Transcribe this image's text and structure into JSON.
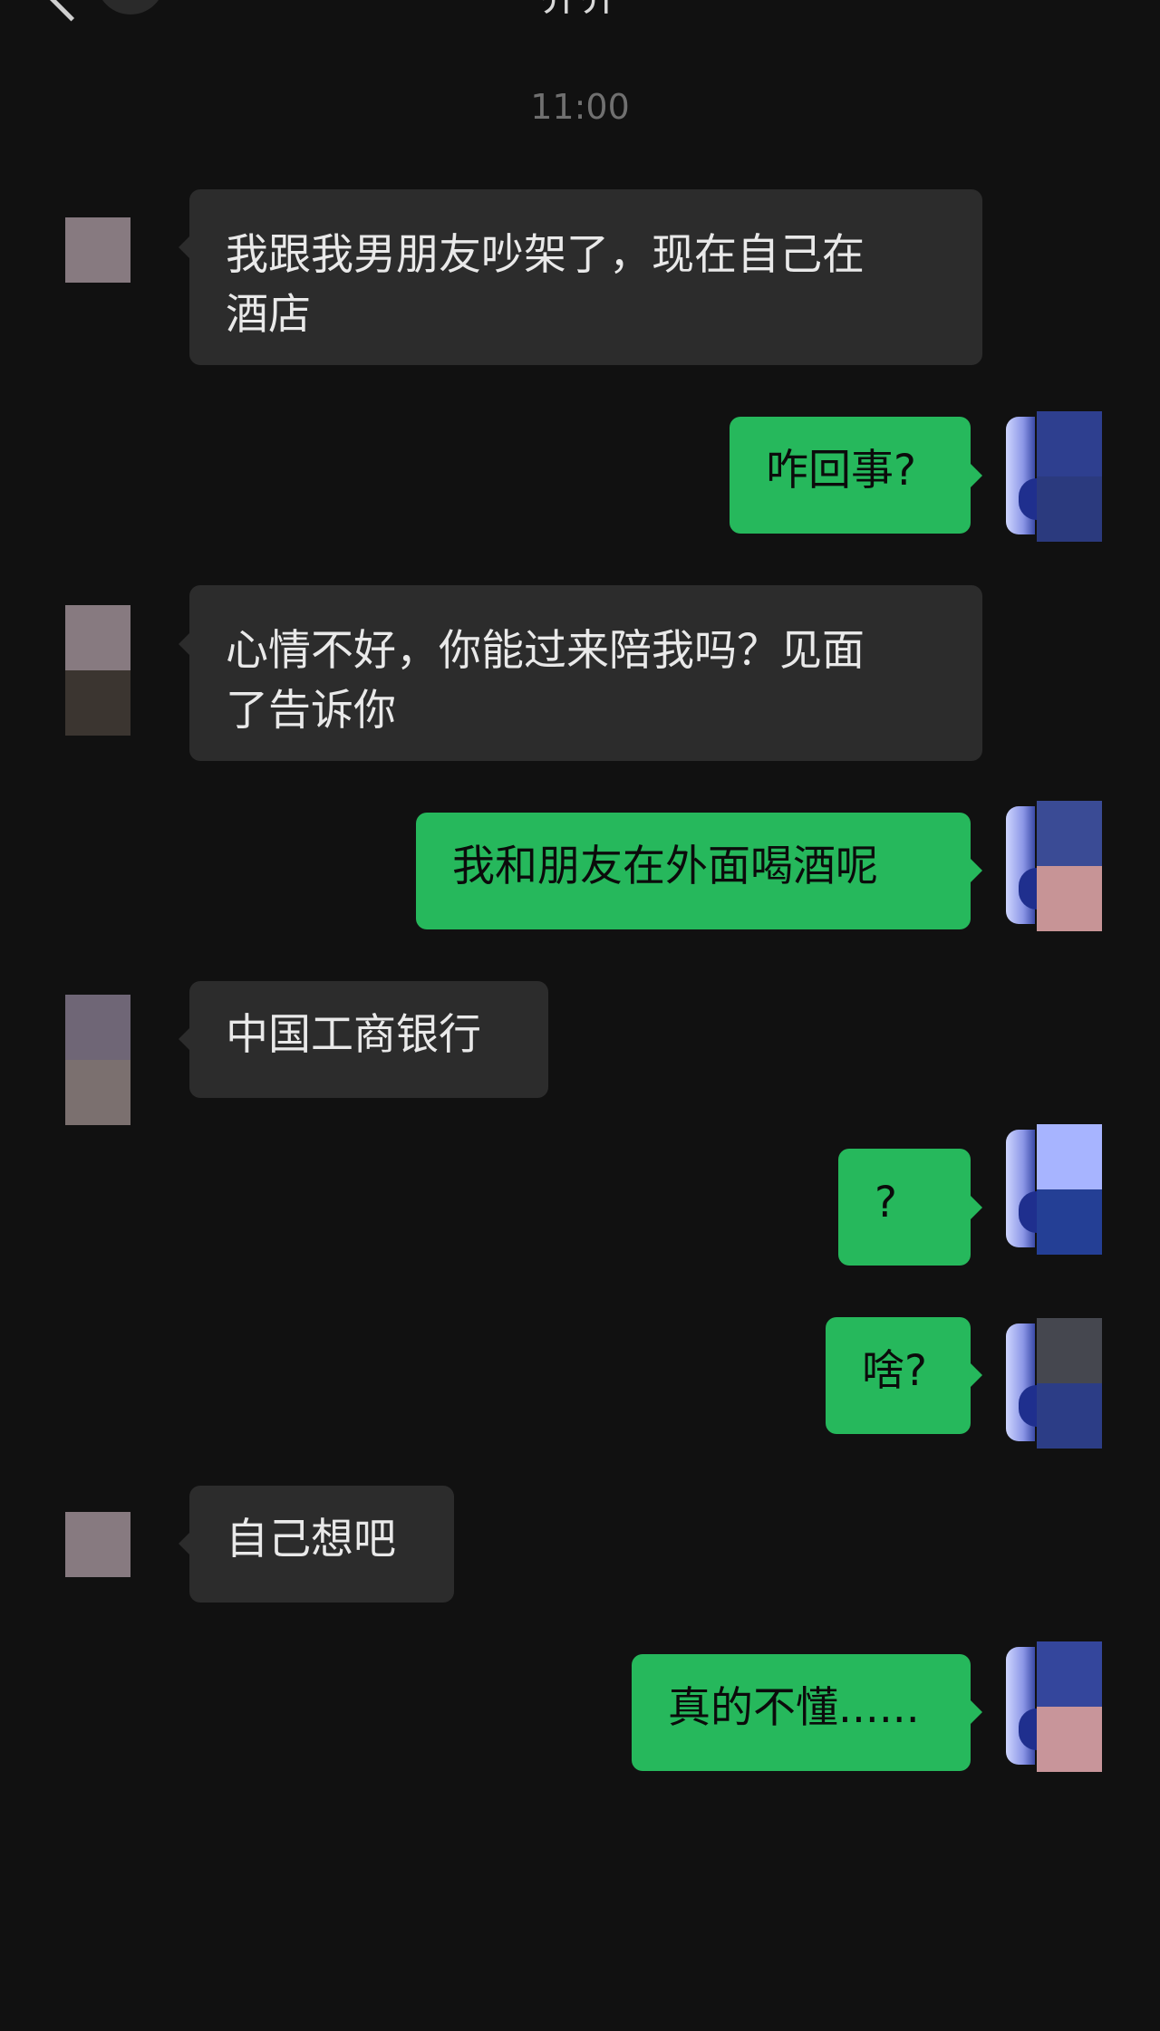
{
  "header": {
    "title": "乔乔",
    "back_icon": "chevron-left-icon"
  },
  "timestamp": "11:00",
  "messages": [
    {
      "side": "in",
      "text": "我跟我男朋友吵架了，现在自己在\n酒店"
    },
    {
      "side": "out",
      "text": "咋回事?"
    },
    {
      "side": "in",
      "text": "心情不好，你能过来陪我吗？见面\n了告诉你"
    },
    {
      "side": "out",
      "text": "我和朋友在外面喝酒呢"
    },
    {
      "side": "in",
      "text": "中国工商银行"
    },
    {
      "side": "out",
      "text": "?"
    },
    {
      "side": "out",
      "text": "啥?"
    },
    {
      "side": "in",
      "text": "自己想吧"
    },
    {
      "side": "out",
      "text": "真的不懂......"
    }
  ],
  "colors": {
    "background": "#111111",
    "incoming_bubble": "#2c2c2c",
    "outgoing_bubble": "#26b85c",
    "timestamp_text": "#707070"
  }
}
